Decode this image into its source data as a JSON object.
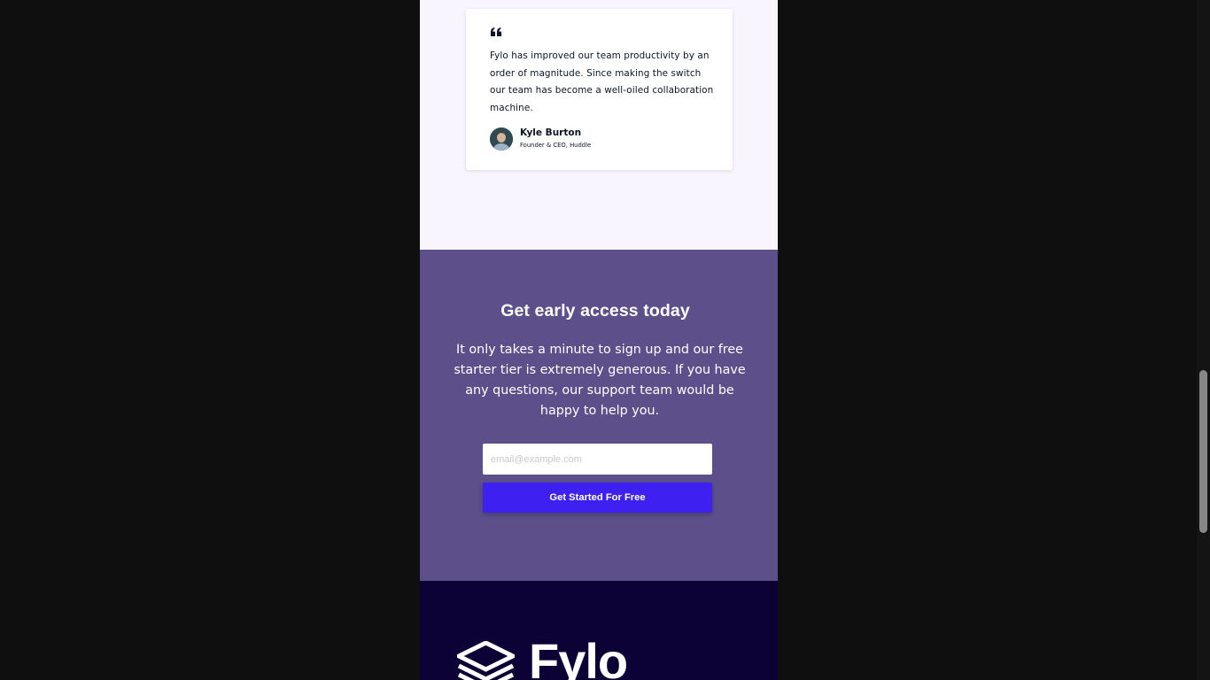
{
  "testimonial": {
    "quote": "Fylo has improved our team productivity by an order of magnitude. Since making the switch our team has become a well-oiled collaboration machine.",
    "author_name": "Kyle Burton",
    "author_role": "Founder & CEO, Huddle"
  },
  "cta": {
    "title": "Get early access today",
    "text": "It only takes a minute to sign up and our free starter tier is extremely generous. If you have any questions, our support team would be happy to help you.",
    "email_placeholder": "email@example.com",
    "button_label": "Get Started For Free"
  },
  "footer": {
    "logo_text": "Fylo"
  },
  "colors": {
    "testimonial_bg": "#f8f5fe",
    "cta_bg": "#5c4f8a",
    "button_bg": "#3e21f1",
    "footer_bg": "#0c0236"
  },
  "icons": {
    "quote": "quote-icon",
    "avatar": "avatar",
    "logo": "fylo-logo-icon"
  }
}
